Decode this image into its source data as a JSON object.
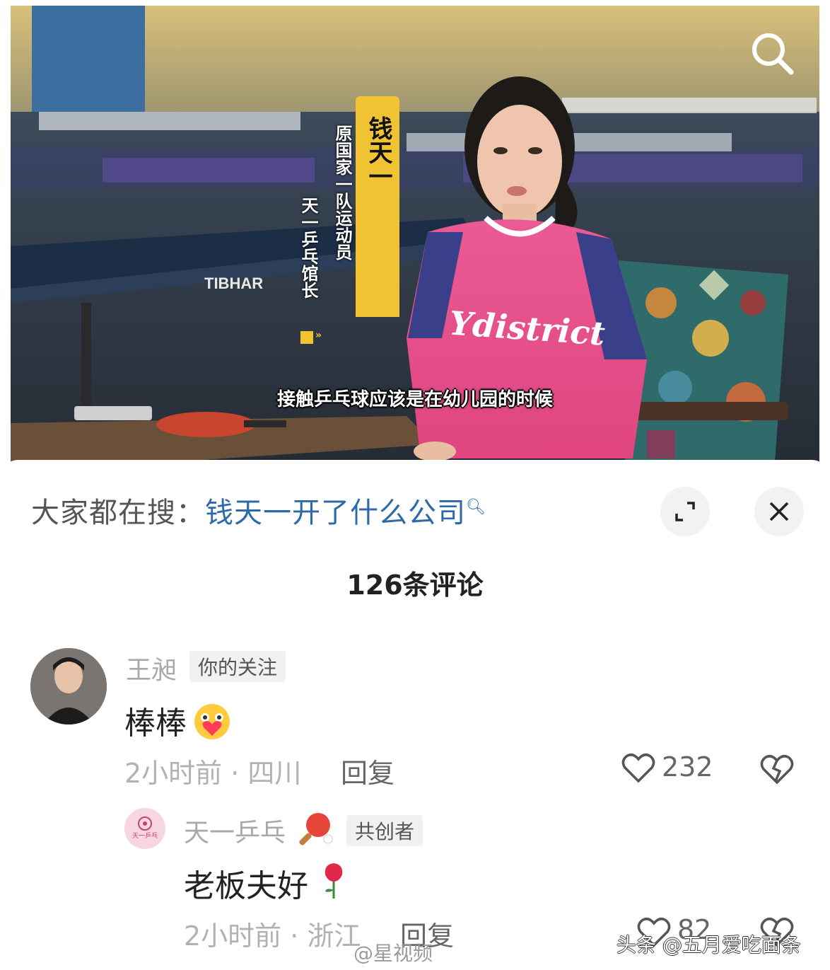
{
  "video": {
    "overlay_name": "钱天一",
    "overlay_title_1": "原国家一队运动员",
    "overlay_title_2": "天一乒乓馆长",
    "overlay_arrows": "»",
    "subtitle": "接触乒乓球应该是在幼儿园的时候",
    "table_brand": "TIBHAR",
    "shirt_text": "Ydistrict",
    "accent_color": "#f1c232"
  },
  "trending": {
    "prefix": "大家都在搜：",
    "query": "钱天一开了什么公司",
    "query_icon": "search-icon"
  },
  "comments_count": "126条评论",
  "comments": [
    {
      "user": "王昶",
      "tag": "你的关注",
      "text": "棒棒",
      "emoji": "blush-heart-emoji",
      "meta": "2小时前 · 四川",
      "reply": "回复",
      "likes": "232"
    },
    {
      "user": "天一乒乓",
      "user_icon": "ping-pong-paddle-icon",
      "tag": "共创者",
      "avatar_text": "天一乒乓",
      "text": "老板夫好",
      "emoji": "rose-emoji",
      "meta": "2小时前 · 浙江",
      "reply": "回复",
      "likes": "82"
    }
  ],
  "watermarks": {
    "weibo": "@星视频",
    "toutiao": "头条 @五月爱吃面条"
  }
}
